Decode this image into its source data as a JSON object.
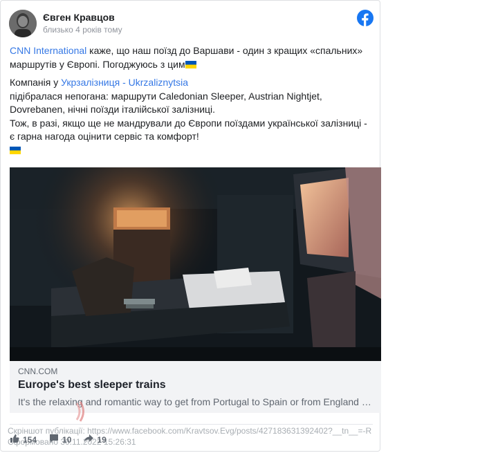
{
  "post": {
    "author": "Євген Кравцов",
    "time": "близько 4 років тому",
    "paragraph1_link": "CNN International",
    "paragraph1_text": " каже, що наш поїзд до Варшави - один з кращих «спальних» маршрутів у Європі. Погоджуюсь з цим",
    "paragraph2_prefix": "Компанія у ",
    "paragraph2_link": "Укрзалізниця - Ukrzaliznytsia",
    "paragraph2_text": "підібралася непогана: маршрути Caledonian Sleeper, Austrian Nightjet, Dovrebanen, нічні поїзди італійської залізниці.",
    "paragraph3_text": "Тож, в разі, якщо ще не мандрували до Європи поїздами української залізниці - є гарна нагода оцінити сервіс та комфорт!"
  },
  "link_preview": {
    "domain": "CNN.COM",
    "title": "Europe's best sleeper trains",
    "description": "It's the relaxing and romantic way to get from Portugal to Spain or from England to Scotland…"
  },
  "stats": {
    "likes": "154",
    "comments": "10",
    "shares": "19"
  },
  "footer": {
    "screenshot_line": "Скріншот публікації: https://www.facebook.com/Kravtsov.Evg/posts/4271836313924​02?__tn__=-R",
    "date_line": "Сформовано 30.11.2022 15:26:31"
  },
  "colors": {
    "link": "#3578e5",
    "facebook_blue": "#1877f2",
    "flag_blue": "#0057b7",
    "flag_yellow": "#ffd700"
  },
  "icons": {
    "facebook": "facebook-logo-icon",
    "like": "thumbs-up-icon",
    "comment": "comment-icon",
    "share": "share-arrow-icon"
  }
}
